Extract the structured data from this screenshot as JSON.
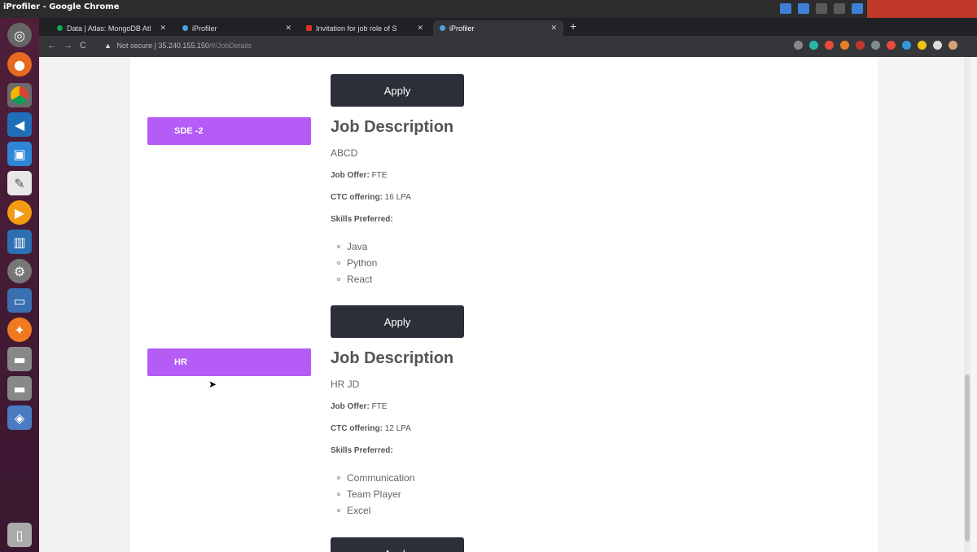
{
  "window": {
    "title": "iProfiler - Google Chrome"
  },
  "tabs": [
    {
      "label": "Data | Atlas: MongoDB Atl",
      "active": false
    },
    {
      "label": "iProfiler",
      "active": false
    },
    {
      "label": "Invitation for job role of S",
      "active": false
    },
    {
      "label": "iProfiler",
      "active": true
    }
  ],
  "address": {
    "security": "Not secure",
    "host": "35.240.155.150",
    "path": "/#/JobDetails"
  },
  "jobs": [
    {
      "role": "SDE -2",
      "heading": "Job Description",
      "description": "ABCD",
      "offer_label": "Job Offer:",
      "offer_value": "FTE",
      "ctc_label": "CTC offering:",
      "ctc_value": "16 LPA",
      "skills_label": "Skills Preferred:",
      "skills": [
        "Java",
        "Python",
        "React"
      ],
      "apply": "Apply"
    },
    {
      "role": "HR",
      "heading": "Job Description",
      "description": "HR JD",
      "offer_label": "Job Offer:",
      "offer_value": "FTE",
      "ctc_label": "CTC offering:",
      "ctc_value": "12 LPA",
      "skills_label": "Skills Preferred:",
      "skills": [
        "Communication",
        "Team Player",
        "Excel"
      ],
      "apply": "Apply"
    }
  ],
  "top_apply": "Apply",
  "colors": {
    "accent": "#b45cf5",
    "button": "#2b2f38"
  }
}
